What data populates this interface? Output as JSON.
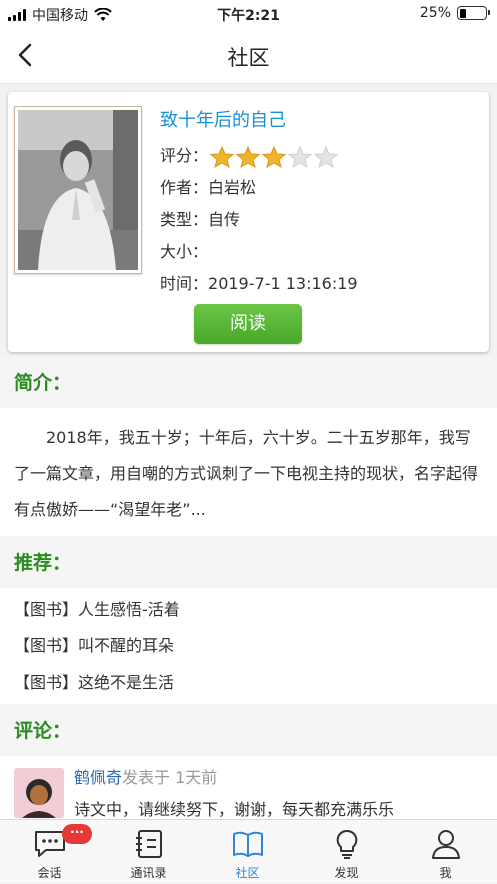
{
  "status_bar": {
    "carrier": "中国移动",
    "time": "下午2:21",
    "battery_text": "25%",
    "battery_level": 0.25
  },
  "nav": {
    "title": "社区"
  },
  "book": {
    "title": "致十年后的自己",
    "rating_label": "评分：",
    "rating": 3,
    "rating_max": 5,
    "author_label": "作者：",
    "author": "白岩松",
    "type_label": "类型：",
    "type": "自传",
    "size_label": "大小：",
    "size": "",
    "time_label": "时间：",
    "time": "2019-7-1 13:16:19",
    "read_label": "阅读"
  },
  "intro": {
    "heading": "简介：",
    "text": "2018年，我五十岁；十年后，六十岁。二十五岁那年，我写了一篇文章，用自嘲的方式讽刺了一下电视主持的现状，名字起得有点傲娇——“渴望年老”..."
  },
  "recommend": {
    "heading": "推荐：",
    "items": [
      {
        "label": "【图书】人生感悟-活着"
      },
      {
        "label": "【图书】叫不醒的耳朵"
      },
      {
        "label": "【图书】这绝不是生活"
      }
    ]
  },
  "comments": {
    "heading": "评论：",
    "items": [
      {
        "user": "鹤佩奇",
        "meta": "发表于 1天前",
        "text": "诗文中，请继续努下，谢谢，每天都充满乐乐"
      }
    ]
  },
  "tabbar": {
    "badge": "···",
    "items": [
      {
        "label": "会话",
        "icon": "chat-icon"
      },
      {
        "label": "通讯录",
        "icon": "contacts-icon"
      },
      {
        "label": "社区",
        "icon": "book-icon"
      },
      {
        "label": "发现",
        "icon": "bulb-icon"
      },
      {
        "label": "我",
        "icon": "user-icon"
      }
    ],
    "active_index": 2
  },
  "colors": {
    "accent_blue": "#1a8fd6",
    "section_green": "#2b8b1f",
    "button_green": "#5ab837",
    "star_gold": "#f0b429",
    "badge_red": "#e53935"
  }
}
